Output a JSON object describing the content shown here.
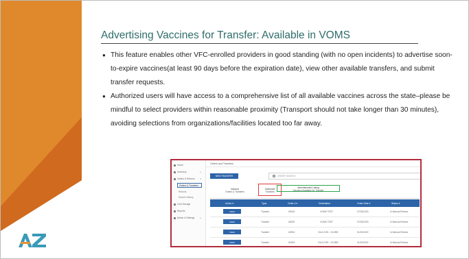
{
  "slide": {
    "title": "Advertising Vaccines for Transfer: Available in VOMS",
    "bullets": [
      "This feature enables other VFC-enrolled providers in good standing (with no open incidents) to advertise soon-to-expire vaccines(at least 90 days before the expiration date), view other available transfers, and submit transfer requests.",
      "Authorized users will have access to a comprehensive list of all available vaccines across the state–please be mindful to select providers within reasonable proximity (Transport should not take longer than 30 minutes), avoiding selections from organizations/facilities located too far away."
    ],
    "logo_text": "AZ",
    "colors": {
      "accent": "#e0892c",
      "title": "#2f6d6a",
      "logo_teal": "#3a9ab8",
      "logo_orange": "#e6923a"
    }
  },
  "screenshot": {
    "header_title": "Orders and Transfers",
    "sidebar": {
      "items": [
        {
          "label": "Home",
          "icon": "home-icon"
        },
        {
          "label": "Inventory",
          "icon": "box-icon"
        },
        {
          "label": "Orders & Returns",
          "icon": "cart-icon"
        },
        {
          "label": "Cold Storage",
          "icon": "snowflake-icon"
        },
        {
          "label": "Reports",
          "icon": "chart-icon"
        },
        {
          "label": "Admin & Settings",
          "icon": "gear-icon"
        }
      ],
      "sub_items": [
        "Orders & Transfers",
        "Returns",
        "Search History"
      ]
    },
    "new_transfer_label": "NEW TRANSFER",
    "search_placeholder": "ORDER SEARCH",
    "tabs": [
      {
        "label": "Inbound",
        "sublabel": "Orders & Transfers"
      },
      {
        "label": "Outbound",
        "sublabel": "Transfers"
      },
      {
        "label": "Advertisement Listing",
        "sublabel": "Vaccines Available for Transfer"
      }
    ],
    "columns": [
      "Action ▾",
      "Type",
      "Order # ▾",
      "Destination",
      "Order Date ▾",
      "Status ▾"
    ],
    "rows": [
      {
        "action": "VIEW",
        "type": "Transfer",
        "order": "63015",
        "destination": "VOMS TEST",
        "date": "07/03/2023",
        "status": "In Manual Review"
      },
      {
        "action": "VIEW",
        "type": "Transfer",
        "order": "63029",
        "destination": "VOMS TEST",
        "date": "07/03/2023",
        "status": "In Manual Review"
      },
      {
        "action": "VIEW",
        "type": "Transfer",
        "order": "63334",
        "destination": "GILA CHD - GLOBE",
        "date": "01/20/2022",
        "status": "In Manual Review"
      },
      {
        "action": "VIEW",
        "type": "Transfer",
        "order": "61553",
        "destination": "GILA CHD - GLOBE",
        "date": "01/20/2022",
        "status": "In Manual Review"
      }
    ]
  }
}
